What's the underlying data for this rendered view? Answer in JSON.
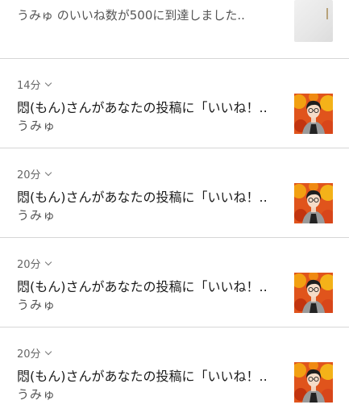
{
  "top_notification": {
    "text": "うみゅ のいいね数が500に到達しました.."
  },
  "notifications": [
    {
      "time": "14分",
      "title": "悶(もん)さんがあなたの投稿に「いいね！..",
      "subtitle": "うみゅ"
    },
    {
      "time": "20分",
      "title": "悶(もん)さんがあなたの投稿に「いいね！..",
      "subtitle": "うみゅ"
    },
    {
      "time": "20分",
      "title": "悶(もん)さんがあなたの投稿に「いいね！..",
      "subtitle": "うみゅ"
    },
    {
      "time": "20分",
      "title": "悶(もん)さんがあなたの投稿に「いいね！..",
      "subtitle": "うみゅ"
    }
  ]
}
